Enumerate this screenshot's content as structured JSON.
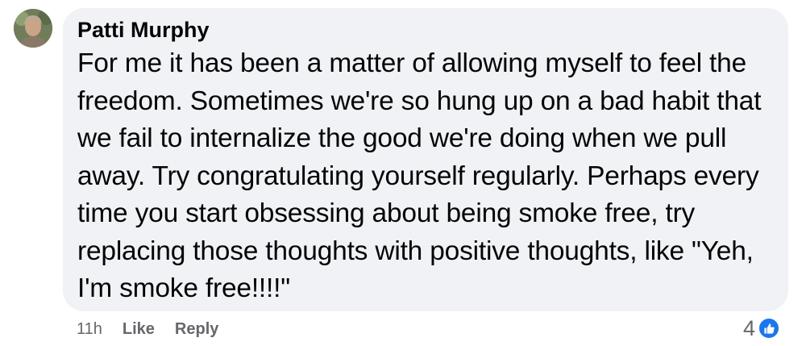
{
  "comment": {
    "author": "Patti Murphy",
    "text": "For me it has been a matter of allowing myself to feel the freedom. Sometimes we're so hung up on a bad habit that we fail to internalize the good we're doing when we pull away. Try congratulating yourself regularly. Perhaps every time you start obsessing about being smoke free, try replacing those thoughts with positive thoughts, like \"Yeh, I'm smoke free!!!!\"",
    "time": "11h",
    "like_label": "Like",
    "reply_label": "Reply",
    "reaction_count": "4",
    "reaction_icon": "thumbs-up-icon"
  },
  "colors": {
    "bubble": "#f0f2f5",
    "text": "#050505",
    "muted": "#65676b",
    "like_blue": "#1877f2"
  }
}
